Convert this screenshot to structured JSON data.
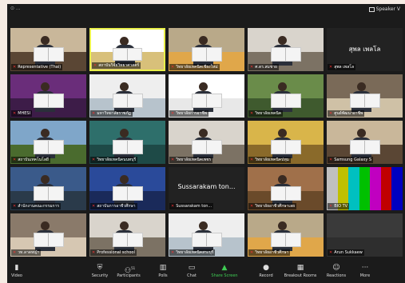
{
  "window": {
    "speaker_view_label": "Speaker V",
    "controls_label": "⊙ ..."
  },
  "colors": {
    "active_border": "#e9f04a",
    "share_green": "#3ecb53",
    "mic_muted": "#e33333"
  },
  "tiles": [
    {
      "name": "Representative (Thai)",
      "style": "office"
    },
    {
      "name": "สถาบันวิจัยวิทยาศาสตร์",
      "style": "banner",
      "active": true
    },
    {
      "name": "วิทยาลัยเทคนิคเชียงใหม่",
      "style": "room"
    },
    {
      "name": "ศ.ดร.สมชาย",
      "style": "plain"
    },
    {
      "name": "สุพล เพลโล",
      "style": "darkname",
      "center_text": "สุพล เพลโล"
    },
    {
      "name": "MHESI",
      "style": "purple"
    },
    {
      "name": "มหาวิทยาลัยราชภัฏ",
      "style": "white"
    },
    {
      "name": "วิทยาลัยการอาชีพ",
      "style": "whitelogo"
    },
    {
      "name": "วิทยาลัยเทคนิค",
      "style": "green"
    },
    {
      "name": "ศูนย์พัฒนาอาชีพ",
      "style": "meeting"
    },
    {
      "name": "สถาบันเทคโนโลยี",
      "style": "field"
    },
    {
      "name": "วิทยาลัยเทคนิคนนทบุรี",
      "style": "teal"
    },
    {
      "name": "วิทยาลัยเทคนิคเพชร",
      "style": "plain"
    },
    {
      "name": "วิทยาลัยเทคนิคปทุม",
      "style": "yellow"
    },
    {
      "name": "Samsung Galaxy S",
      "style": "office"
    },
    {
      "name": "สำนักงานคณะกรรมการ",
      "style": "screen"
    },
    {
      "name": "สถาบันการอาชีวศึกษา",
      "style": "blue"
    },
    {
      "name": "Sussarakam ton...",
      "style": "darkname",
      "center_text": "Sussarakam ton..."
    },
    {
      "name": "วิทยาลัยอาชีวศึกษาเลย",
      "style": "wood"
    },
    {
      "name": "BIO TV",
      "style": "colorbars"
    },
    {
      "name": "วท.ลาดหญ้า",
      "style": "shelves"
    },
    {
      "name": "Professional school",
      "style": "plain"
    },
    {
      "name": "วิทยาลัยเทคนิคสระบุรี",
      "style": "white"
    },
    {
      "name": "วิทยาลัยอาชีวศึกษา",
      "style": "room"
    },
    {
      "name": "Arun Sukkaew",
      "style": "darkgrey"
    }
  ],
  "toolbar": {
    "video": "Video",
    "security": "Security",
    "participants": "Participants",
    "participants_count": "51",
    "polls": "Polls",
    "chat": "Chat",
    "share_screen": "Share Screen",
    "record": "Record",
    "breakout_rooms": "Breakout Rooms",
    "reactions": "Reactions",
    "more": "More"
  }
}
